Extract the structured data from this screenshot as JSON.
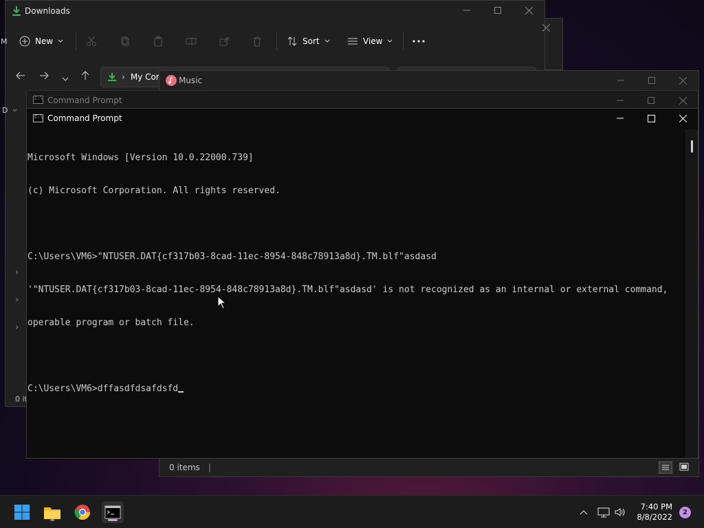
{
  "explorer": {
    "title": "Downloads",
    "toolbar": {
      "new_label": "New",
      "sort_label": "Sort",
      "view_label": "View"
    },
    "address_text": "My Con",
    "status_text": "0 it",
    "left_letters": [
      "M",
      "D"
    ]
  },
  "music": {
    "title": "Music",
    "status_text": "0 items"
  },
  "cmd_back": {
    "title": "Command Prompt"
  },
  "cmd": {
    "title": "Command Prompt",
    "lines": [
      "Microsoft Windows [Version 10.0.22000.739]",
      "(c) Microsoft Corporation. All rights reserved.",
      "",
      "C:\\Users\\VM6>\"NTUSER.DAT{cf317b03-8cad-11ec-8954-848c78913a8d}.TM.blf\"asdasd",
      "'\"NTUSER.DAT{cf317b03-8cad-11ec-8954-848c78913a8d}.TM.blf\"asdasd' is not recognized as an internal or external command,",
      "operable program or batch file.",
      ""
    ],
    "prompt_line": "C:\\Users\\VM6>dffasdfdsafdsfd"
  },
  "taskbar": {
    "apps": [
      {
        "name": "Start",
        "icon": "windows-logo-icon"
      },
      {
        "name": "File Explorer",
        "icon": "folder-icon"
      },
      {
        "name": "Google Chrome",
        "icon": "chrome-icon"
      },
      {
        "name": "Command Prompt",
        "icon": "terminal-icon"
      }
    ],
    "clock_time": "7:40 PM",
    "clock_date": "8/8/2022",
    "notification_count": "2"
  },
  "colors": {
    "accent_download": "#3ab65a",
    "music_icon": "#e8707a",
    "notification_badge": "#c08fe6",
    "console_text": "#cccccc",
    "console_bg": "#0c0c0c"
  }
}
